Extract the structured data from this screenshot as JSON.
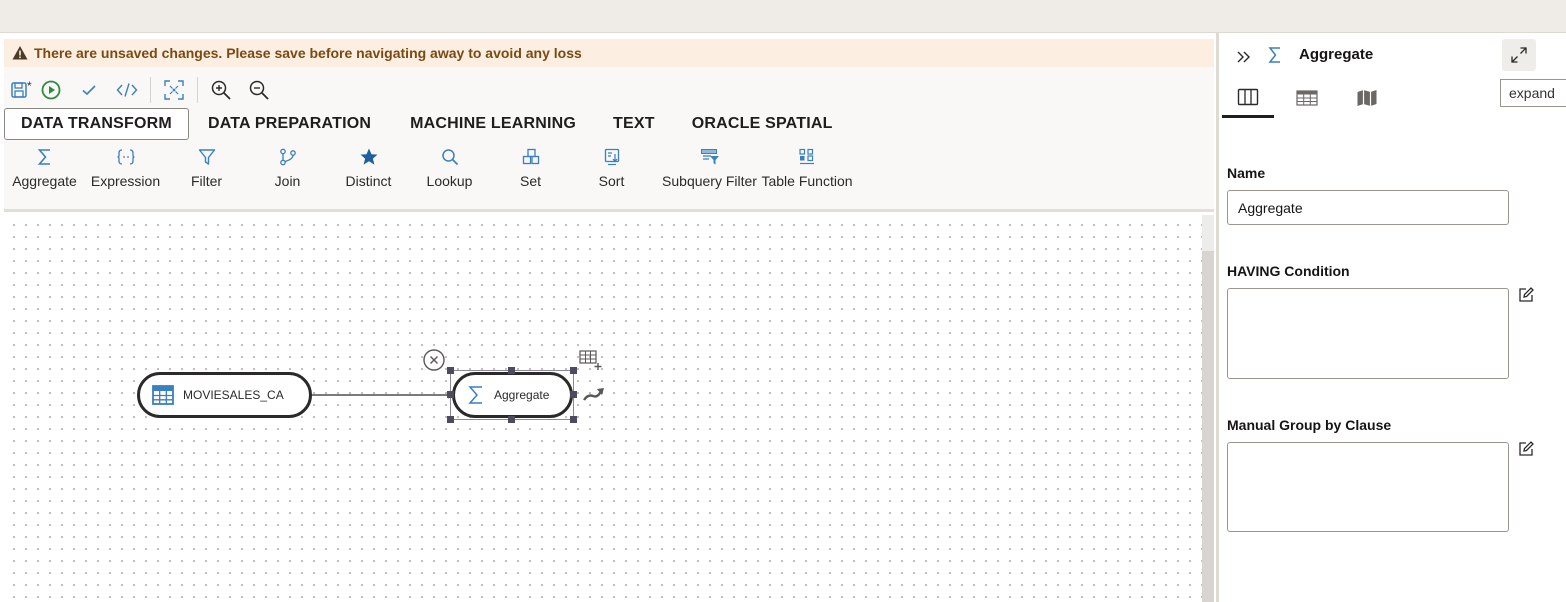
{
  "warning": {
    "text": "There are unsaved changes. Please save before navigating away to avoid any loss"
  },
  "toolbar": {
    "save_modified_marker": "*",
    "icons": [
      "save-icon",
      "run-icon",
      "validate-icon",
      "code-icon",
      "fit-to-screen-icon",
      "zoom-in-icon",
      "zoom-out-icon"
    ]
  },
  "tabs": [
    {
      "label": "DATA TRANSFORM",
      "active": true
    },
    {
      "label": "DATA PREPARATION",
      "active": false
    },
    {
      "label": "MACHINE LEARNING",
      "active": false
    },
    {
      "label": "TEXT",
      "active": false
    },
    {
      "label": "ORACLE SPATIAL",
      "active": false
    }
  ],
  "palette": [
    {
      "label": "Aggregate",
      "icon": "sigma-icon"
    },
    {
      "label": "Expression",
      "icon": "expression-icon"
    },
    {
      "label": "Filter",
      "icon": "filter-icon"
    },
    {
      "label": "Join",
      "icon": "join-icon"
    },
    {
      "label": "Distinct",
      "icon": "star-icon"
    },
    {
      "label": "Lookup",
      "icon": "magnifier-icon"
    },
    {
      "label": "Set",
      "icon": "set-icon"
    },
    {
      "label": "Sort",
      "icon": "sort-icon"
    },
    {
      "label": "Subquery Filter",
      "icon": "subquery-filter-icon"
    },
    {
      "label": "Table Function",
      "icon": "table-function-icon"
    }
  ],
  "canvas": {
    "nodes": [
      {
        "label": "MOVIESALES_CA",
        "icon": "table-icon"
      },
      {
        "label": "Aggregate",
        "icon": "sigma-icon",
        "selected": true
      }
    ]
  },
  "panel": {
    "title": "Aggregate",
    "expand_tooltip": "expand",
    "tabs": [
      "columns-icon",
      "table-grid-icon",
      "map-icon"
    ],
    "name_label": "Name",
    "name_value": "Aggregate",
    "having_label": "HAVING Condition",
    "having_value": "",
    "group_by_label": "Manual Group by Clause",
    "group_by_value": ""
  },
  "colors": {
    "accent_blue": "#3a7fc1",
    "run_green": "#2e8b3d",
    "warning_bg": "#fcefe1",
    "warning_text": "#7a4a12"
  }
}
